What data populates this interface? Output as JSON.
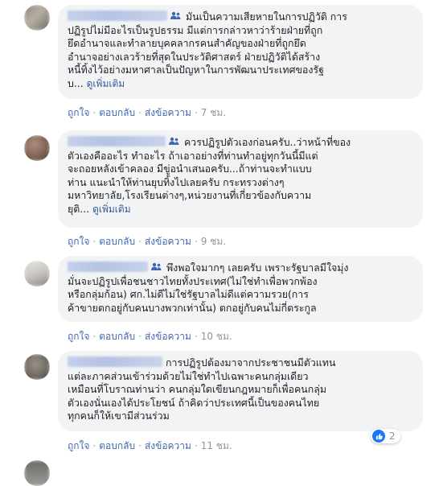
{
  "comments": [
    {
      "name": "",
      "text": "มันเป็นความเสียหายในการปฏิวัติ การ\nปฏิรูปไม่มีอะไรเป็นรูปธรรม มีแต่การกล่าวหาว่าร้ายฝ่ายที่ถูก\nยึดอำนาจและทำลายบุคคลากรคนสำคัญของฝ่ายที่ถูกยึด\nอำนาจอย่างเลวร้ายที่สุดในประวัติศาสตร์ ฝ่ายปฏิวัติได้สร้าง\nหนี้ทิ้งไว้อย่างมหาศาลเป็นปัญหาในการพัฒนาประเทศของรัฐ\nบ...",
      "see_more": "ดูเพิ่มเติม",
      "like": "ถูกใจ",
      "reply": "ตอบกลับ",
      "translate": "ส่งข้อความ",
      "time": "7 ชม."
    },
    {
      "name": "",
      "text": "ควรปฏิรูปตัวเองก่อนครับ..ว่าหน้าที่ของ\nตัวเองคืออะไร ทำอะไร ถ้าเอาอย่างที่ท่านทำอยู่ทุกวันนี้มีแต่\nจะถอยหลังเข้าคลอง มีขู่อนำเสนอครับ...ถ้าท่านจะทำแบบ\nท่าน แนะนำให้ท่านยุบทิ้งไปเลยครับ กระทรวงต่างๆ\nมหาวิทยาลัย,โรงเรียนต่างๆ,หน่วยงานที่เกี่ยวข้องกับความ\nยุติ...",
      "see_more": "ดูเพิ่มเติม",
      "like": "ถูกใจ",
      "reply": "ตอบกลับ",
      "translate": "ส่งข้อความ",
      "time": "9 ชม."
    },
    {
      "name": "",
      "text": "พึงพอใจมากๆ เลยครับ เพราะรัฐบาลมีใจมุ่ง\nมั่นจะปฏิรูปเพื่อชนชาวไทยทั้งประเทศ(ไม่ใช่ทำเพื่อพวกพ้อง\nหรือกลุ่มก้อน) ศก.ไม่ดีไม่ใช่รัฐบาลไม่ดีแต่ความรวย(การ\nค้าขายตกอยู่กับคนบางพวกเท่านั้น) ตกอยู่กับคนไม่กี่ตระกูล",
      "like": "ถูกใจ",
      "reply": "ตอบกลับ",
      "translate": "ส่งข้อความ",
      "time": "10 ชม."
    },
    {
      "name": "",
      "text": "การปฏิรูปต้องมาจากประชาชนมีตัวแทน\nแต่ละภาคส่วนเข้าร่วมด้วยไม่ใช่ทำไปเฉพาะคนกลุ่มเดียว\nเหมือนที่โบราณท่านว่า คนกลุ่มใดเขียนกฎหมายก็เพื่อคนกลุ่ม\nตัวเองนั่นเองได้ประโยชน์ ถ้าคิดว่าประเทศนี้เป็นของคนไทย\nทุกคนก็ให้เขามีส่วนร่วม",
      "like": "ถูกใจ",
      "reply": "ตอบกลับ",
      "translate": "ส่งข้อความ",
      "time": "11 ชม.",
      "reaction_count": "2"
    }
  ],
  "colors": {
    "link": "#385898",
    "action": "#4267b2",
    "bubble": "#f2f3f5",
    "like": "#1877f2"
  },
  "icons": {
    "badge": "top-fan-icon",
    "reaction": "like-icon"
  }
}
